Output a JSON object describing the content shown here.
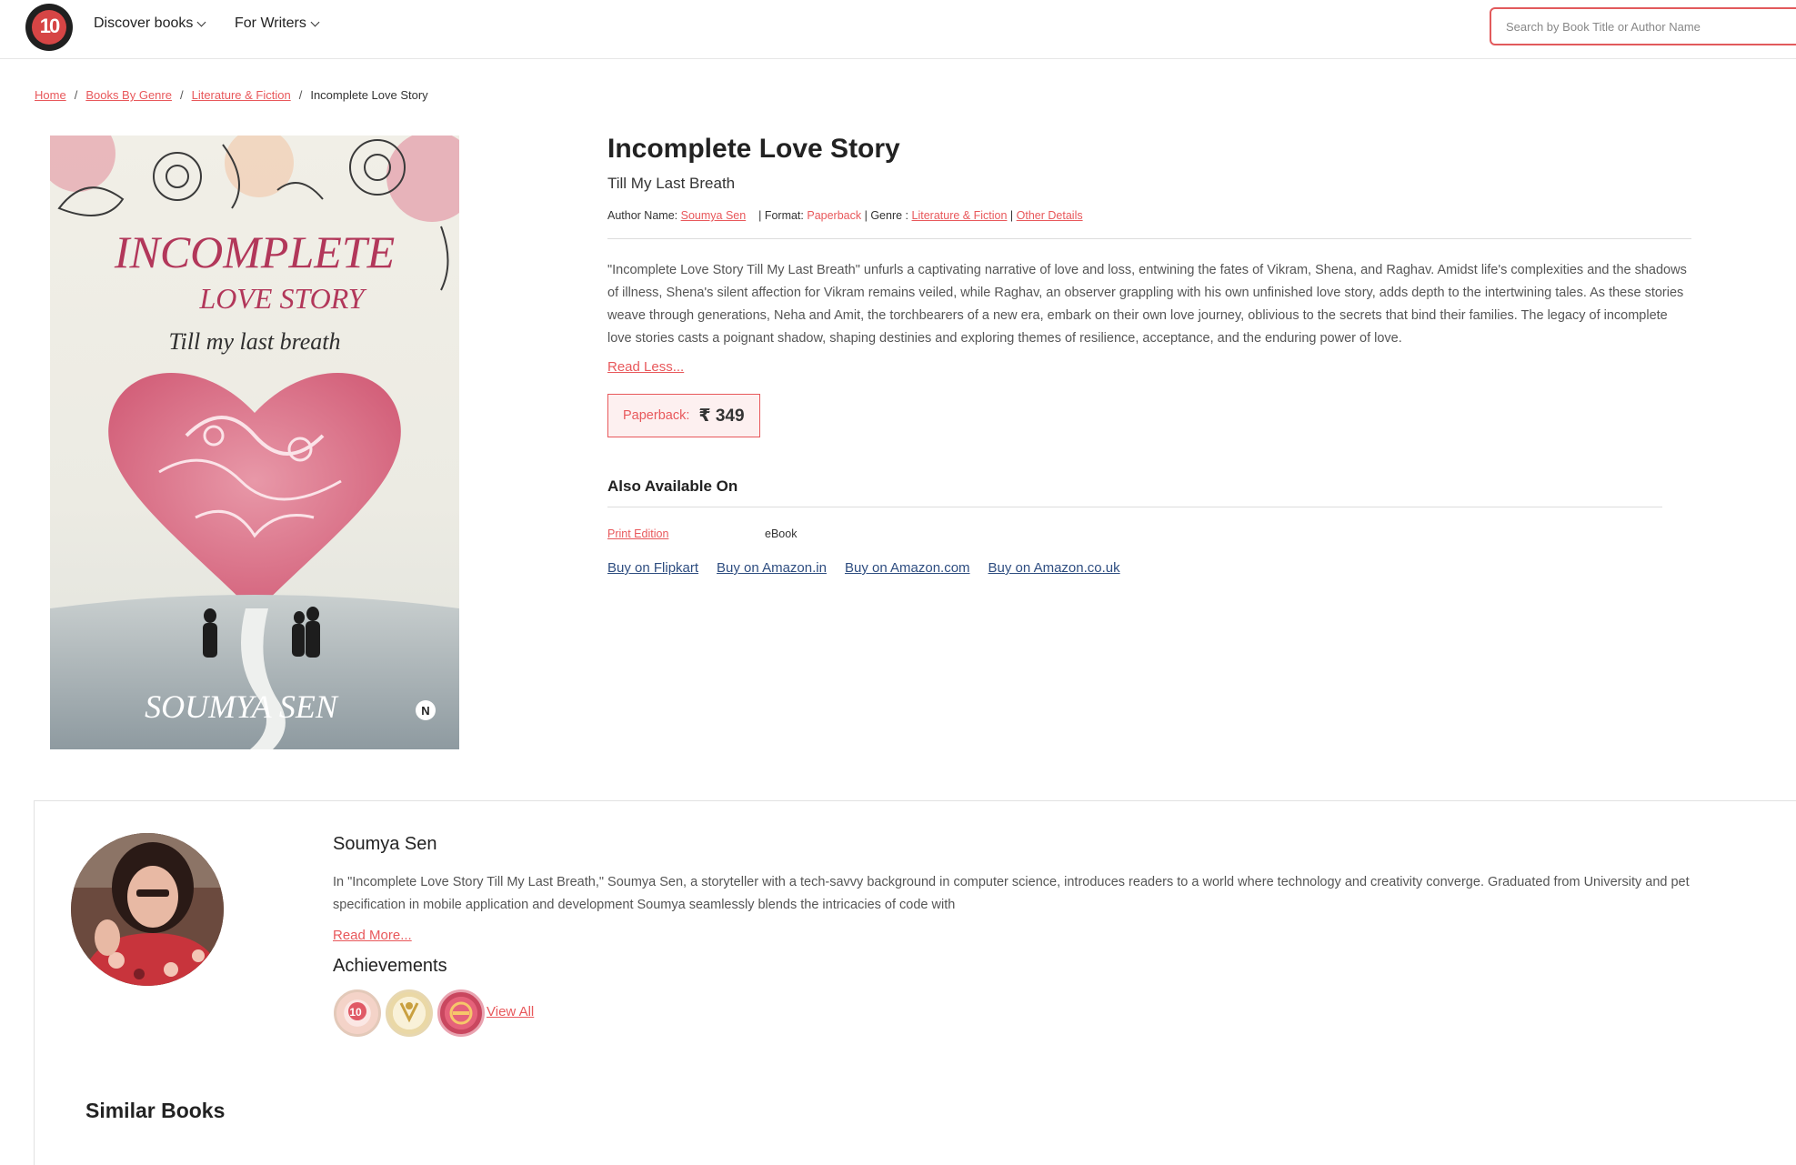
{
  "header": {
    "logo_text": "10",
    "nav": [
      {
        "label": "Discover books"
      },
      {
        "label": "For Writers"
      }
    ],
    "search_placeholder": "Search by Book Title or Author Name"
  },
  "breadcrumb": {
    "items": [
      "Home",
      "Books By Genre",
      "Literature & Fiction"
    ],
    "current": "Incomplete Love Story",
    "separator": "/"
  },
  "cover": {
    "title_line1": "INCOMPLETE",
    "title_line2": "LOVE STORY",
    "subtitle": "Till my last breath",
    "author": "SOUMYA SEN",
    "publisher_mark": "N"
  },
  "book": {
    "title": "Incomplete Love Story",
    "subtitle": "Till My Last Breath",
    "author_label": "Author Name:",
    "author": "Soumya Sen",
    "format_label": "| Format:",
    "format": "Paperback",
    "genre_label": "| Genre :",
    "genre": "Literature & Fiction",
    "other_sep": "|",
    "other_details": "Other Details",
    "description": "\"Incomplete Love Story Till My Last Breath\" unfurls a captivating narrative of love and loss, entwining the fates of Vikram, Shena, and Raghav. Amidst life's complexities and the shadows of illness, Shena's silent affection for Vikram remains veiled, while Raghav, an observer grappling with his own unfinished love story, adds depth to the intertwining tales. As these stories weave through generations, Neha and Amit, the torchbearers of a new era, embark on their own love journey, oblivious to the secrets that bind their families. The legacy of incomplete love stories casts a poignant shadow, shaping destinies and exploring themes of resilience, acceptance, and the enduring power of love.",
    "read_less": "Read Less...",
    "price_label": "Paperback:",
    "price": "₹ 349"
  },
  "availability": {
    "heading": "Also Available On",
    "print_edition": "Print Edition",
    "ebook": "eBook",
    "stores": [
      "Buy on Flipkart",
      "Buy on Amazon.in",
      "Buy on Amazon.com",
      "Buy on Amazon.co.uk"
    ]
  },
  "author_section": {
    "name": "Soumya Sen",
    "bio_line1": "In \"Incomplete Love Story Till My Last Breath,\" Soumya Sen, a storyteller with a tech-savvy background in computer science, introduces readers to a world where technology and creativity converge. Graduated from University and pet",
    "bio_line2": "specification in mobile  application and development Soumya seamlessly blends the intricacies of code with",
    "read_more": "Read More...",
    "achievements_title": "Achievements",
    "view_all": "View All"
  },
  "similar_books": {
    "heading": "Similar Books"
  },
  "colors": {
    "accent": "#e8585b",
    "link_blue": "#2e4d80",
    "heart_pink": "#d8627a"
  }
}
